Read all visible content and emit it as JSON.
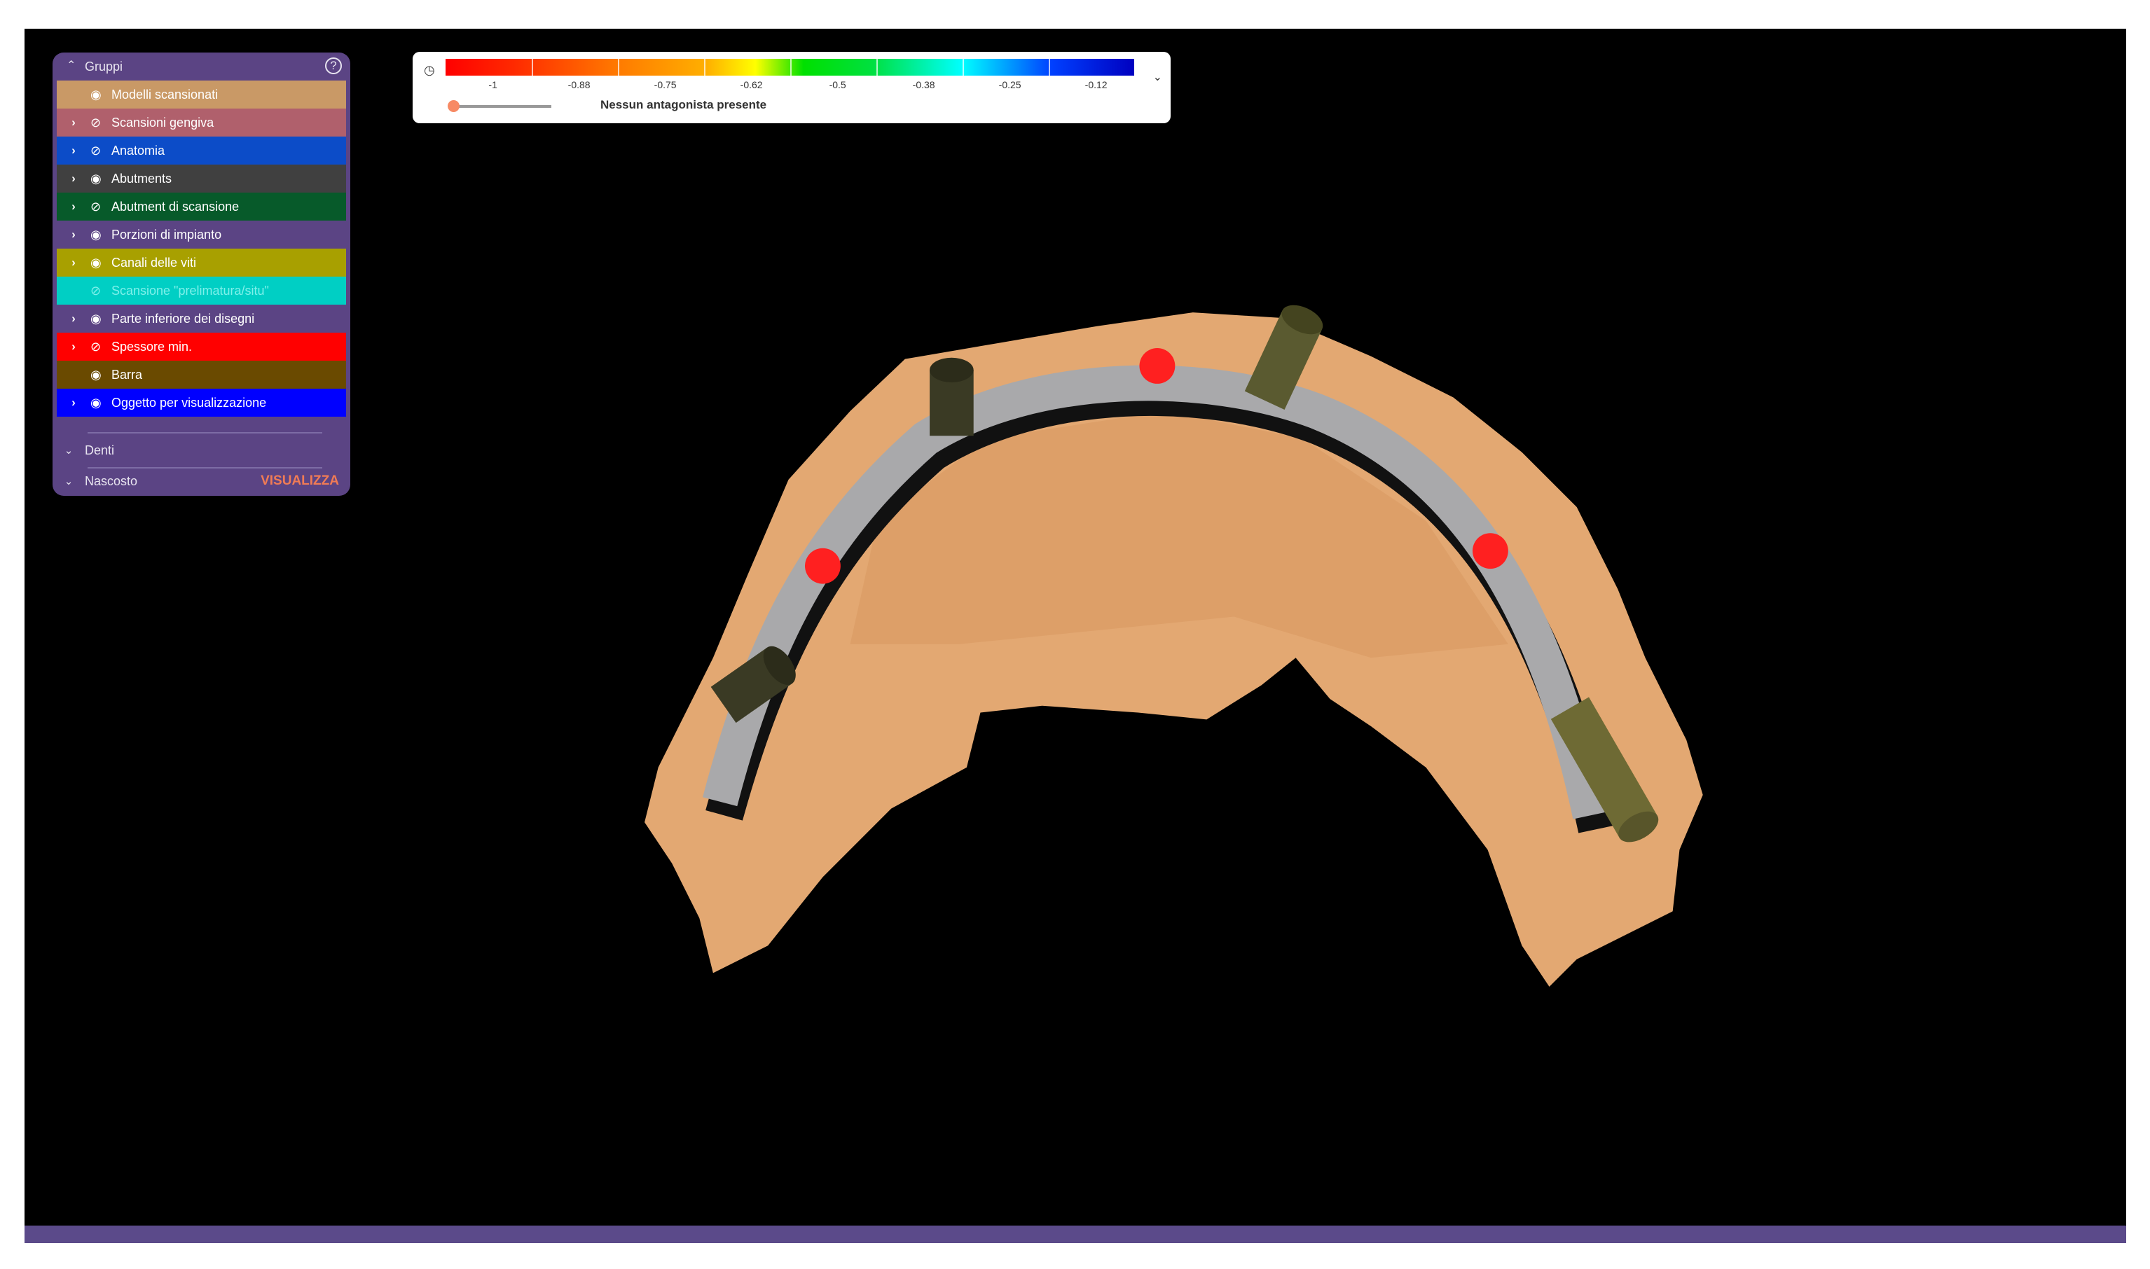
{
  "panel": {
    "title": "Gruppi",
    "help_icon": "?",
    "groups": [
      {
        "label": "Modelli scansionati",
        "color": "#c99966",
        "expand": false,
        "visible": true
      },
      {
        "label": "Scansioni gengiva",
        "color": "#b0606c",
        "expand": true,
        "visible": false
      },
      {
        "label": "Anatomia",
        "color": "#0c4cc8",
        "expand": true,
        "visible": false
      },
      {
        "label": "Abutments",
        "color": "#404040",
        "expand": true,
        "visible": true
      },
      {
        "label": "Abutment di scansione",
        "color": "#075a2a",
        "expand": true,
        "visible": false
      },
      {
        "label": "Porzioni di impianto",
        "color": "#5b4484",
        "expand": true,
        "visible": true
      },
      {
        "label": "Canali delle viti",
        "color": "#a8a000",
        "expand": true,
        "visible": true
      },
      {
        "label": "Scansione \"prelimatura/situ\"",
        "color": "#00cfc4",
        "expand": false,
        "visible": false
      },
      {
        "label": "Parte inferiore dei disegni",
        "color": "#5b4484",
        "expand": true,
        "visible": true
      },
      {
        "label": "Spessore min.",
        "color": "#ff0000",
        "expand": true,
        "visible": false
      },
      {
        "label": "Barra",
        "color": "#6a4a00",
        "expand": false,
        "visible": true
      },
      {
        "label": "Oggetto per visualizzazione",
        "color": "#0000ff",
        "expand": true,
        "visible": true
      }
    ],
    "denti": "Denti",
    "nascosto": "Nascosto",
    "visualizza": "VISUALIZZA"
  },
  "scale": {
    "ticks": [
      "-1",
      "-0.88",
      "-0.75",
      "-0.62",
      "-0.5",
      "-0.38",
      "-0.25",
      "-0.12"
    ],
    "message": "Nessun antagonista presente",
    "slider_value": 0
  }
}
